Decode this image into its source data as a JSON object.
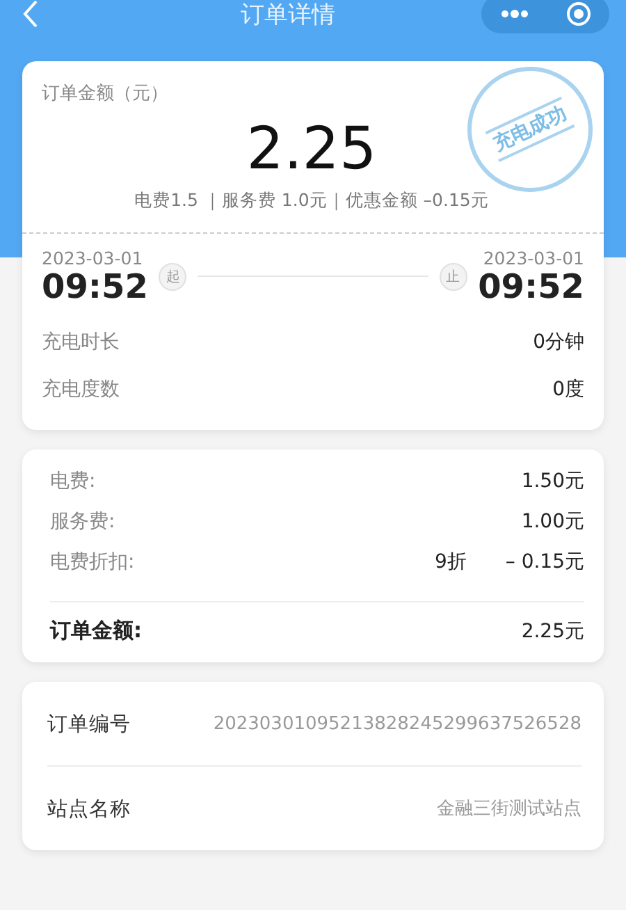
{
  "nav": {
    "title": "订单详情"
  },
  "summary": {
    "label": "订单金额（元）",
    "amount": "2.25",
    "breakdown": "电费1.5 ｜服务费 1.0元｜优惠金额 –0.15元",
    "stamp": "充电成功"
  },
  "session": {
    "start": {
      "date": "2023-03-01",
      "time": "09:52",
      "tag": "起"
    },
    "end": {
      "date": "2023-03-01",
      "time": "09:52",
      "tag": "止"
    },
    "rows": [
      {
        "label": "充电时长",
        "value": "0分钟"
      },
      {
        "label": "充电度数",
        "value": "0度"
      }
    ]
  },
  "fees": {
    "rows": [
      {
        "label": "电费:",
        "value": "1.50元"
      },
      {
        "label": "服务费:",
        "value": "1.00元"
      },
      {
        "label": "电费折扣:",
        "note": "9折",
        "value": "– 0.15元"
      }
    ],
    "total": {
      "label": "订单金额:",
      "value": "2.25元"
    }
  },
  "info": [
    {
      "label": "订单编号",
      "value": "20230301095213828245299637526528"
    },
    {
      "label": "站点名称",
      "value": "金融三街测试站点"
    }
  ]
}
